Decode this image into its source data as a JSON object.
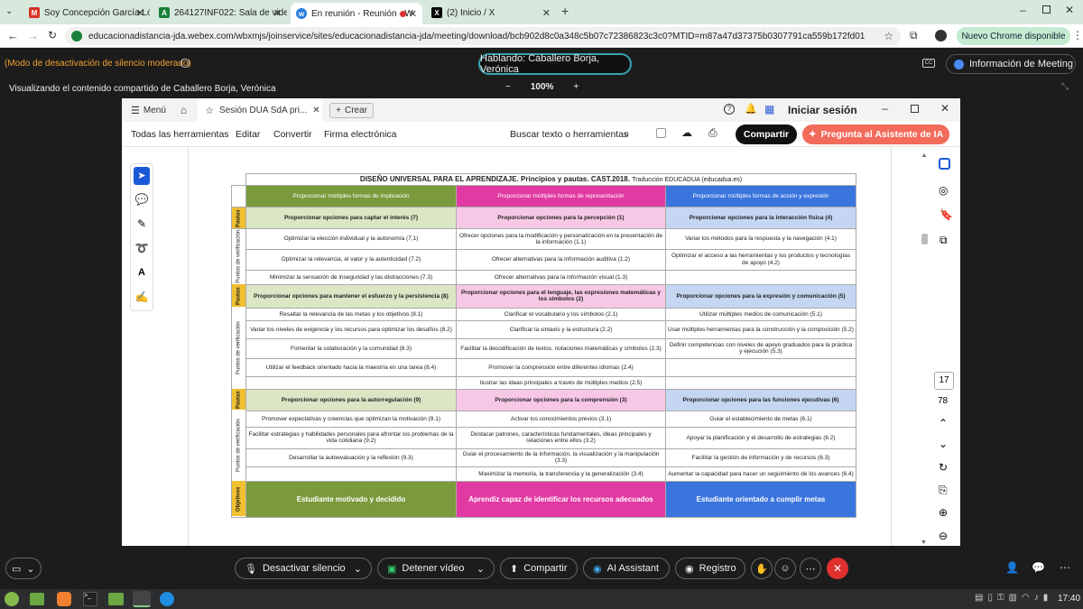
{
  "tabs": [
    {
      "label": "Soy Concepción García Lópe",
      "icon": "gmail-icon"
    },
    {
      "label": "264127INF022: Sala de vide",
      "icon": "sheet-icon"
    },
    {
      "label": "En reunión - Reunión - W",
      "icon": "webex-icon"
    },
    {
      "label": "(2) Inicio / X",
      "icon": "x-icon"
    }
  ],
  "browser": {
    "url": "educacionadistancia-jda.webex.com/wbxmjs/joinservice/sites/educacionadistancia-jda/meeting/download/bcb902d8c0a348c5b07c72386823c3c0?MTID=m87a47d37375b0307791ca559b172fd01",
    "new_chrome": "Nuevo Chrome disponible"
  },
  "webex": {
    "mute_mode": "(Modo de desactivación de silencio moderado)",
    "speaking": "Hablando: Caballero Borja, Verónica",
    "meeting_info": "Información de Meeting",
    "viewing": "Visualizando el contenido compartido de Caballero Borja, Verónica",
    "zoom": "100%",
    "zoom_minus": "−",
    "zoom_plus": "+"
  },
  "app": {
    "menu": "Menú",
    "tab_title": "Sesión DUA SdA pri...",
    "create": "Crear",
    "sign_in": "Iniciar sesión",
    "tools": [
      "Todas las herramientas",
      "Editar",
      "Convertir",
      "Firma electrónica"
    ],
    "search": "Buscar texto o herramientas",
    "share": "Compartir",
    "ai": "Pregunta al Asistente de IA",
    "page_current": "17",
    "page_total": "78"
  },
  "table": {
    "title": "DISEÑO UNIVERSAL PARA EL APRENDIZAJE. Principios y pautas. CAST.2018.",
    "title_suffix": "Traducción EDUCADUA (educadua.es)",
    "principles": [
      "Proporcionar múltiples formas de implicación",
      "Proporcionar múltiples formas de representación",
      "Proporcionar múltiples formas de acción y expresión"
    ],
    "side_pautas": "Pautas",
    "side_verif": "Puntos de verificación",
    "side_obj": "Objetivos",
    "block1": {
      "pautas": [
        "Proporcionar opciones para captar el interés (7)",
        "Proporcionar opciones para la percepción (1)",
        "Proporcionar opciones para la interacción física (4)"
      ],
      "rows": [
        [
          "Optimizar la elección individual y la autonomía (7,1)",
          "Ofrecer opciones para la modificación y personalización en la presentación de la información (1.1)",
          "Variar los métodos para la respuesta y la navegación (4.1)"
        ],
        [
          "Optimizar la relevancia, el valor y la autenticidad (7.2)",
          "Ofrecer alternativas para la información auditiva (1.2)",
          "Optimizar el acceso a las herramientas y los productos y tecnologías de apoyo (4.2)"
        ],
        [
          "Minimizar la sensación de inseguridad y las distracciones (7.3)",
          "Ofrecer alternativas para la información visual (1.3)",
          ""
        ]
      ]
    },
    "block2": {
      "pautas": [
        "Proporcionar opciones para mantener el esfuerzo y la persistencia (8)",
        "Proporcionar opciones para el lenguaje, las expresiones matemáticas y los símbolos (2)",
        "Proporcionar opciones para la expresión y comunicación (5)"
      ],
      "rows": [
        [
          "Resaltar la relevancia de las metas y los objetivos (8.1)",
          "Clarificar el vocabulario y los símbolos (2.1)",
          "Utilizar múltiples medios de comunicación (5.1)"
        ],
        [
          "Variar los niveles de exigencia y los recursos para optimizar los desafíos (8.2)",
          "Clarificar la sintaxis y la estructura (2.2)",
          "Usar múltiples herramientas para la construcción y la composición (5.2)"
        ],
        [
          "Fomentar la colaboración y la comunidad (8.3)",
          "Facilitar la decodificación de textos, notaciones matemáticas y símbolos (2.3)",
          "Definir competencias con niveles de apoyo graduados para la práctica y ejecución (5.3)"
        ],
        [
          "Utilizar el feedback orientado hacia la maestría en una tarea (8.4)",
          "Promover la comprensión entre diferentes idiomas (2.4)",
          ""
        ],
        [
          "",
          "Ilustrar las ideas principales a través de múltiples medios (2.5)",
          ""
        ]
      ]
    },
    "block3": {
      "pautas": [
        "Proporcionar opciones para la autorregulación (9)",
        "Proporcionar opciones para la comprensión (3)",
        "Proporcionar opciones para las funciones ejecutivas (6)"
      ],
      "rows": [
        [
          "Promover expectativas y creencias que optimizan la motivación (9.1)",
          "Activar los conocimientos previos (3.1)",
          "Guiar el establecimiento de metas (6.1)"
        ],
        [
          "Facilitar estrategias y habilidades personales para afrontar los problemas de la vida cotidiana (9.2)",
          "Destacar patrones, características fundamentales, ideas principales y relaciones entre ellos (3.2)",
          "Apoyar la planificación y el desarrollo de estrategias (6.2)"
        ],
        [
          "Desarrollar la autoevaluación y la reflexión (9.3)",
          "Guiar el procesamiento de la información, la visualización y la manipulación (3.3)",
          "Facilitar la gestión de información y de recursos (6.3)"
        ],
        [
          "",
          "Maximizar la memoria, la transferencia y la generalización (3.4)",
          "Aumentar la capacidad para hacer un seguimiento de los avances (6.4)"
        ]
      ]
    },
    "objectives": [
      "Estudiante motivado y decidido",
      "Aprendiz capaz de identificar los recursos adecuados",
      "Estudiante orientado a cumplir metas"
    ]
  },
  "controls": {
    "mute": "Desactivar silencio",
    "video": "Detener vídeo",
    "share": "Compartir",
    "ai": "AI Assistant",
    "record": "Registro"
  },
  "taskbar": {
    "time": "17:40"
  }
}
